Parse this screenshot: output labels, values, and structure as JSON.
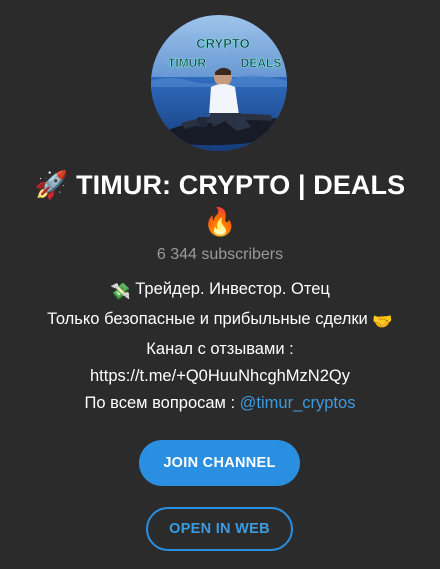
{
  "channel": {
    "title_prefix_emoji": "🚀",
    "title": "TIMUR: CRYPTO | DEALS",
    "title_suffix_emoji": "🔥",
    "subscribers": "6 344 subscribers",
    "avatar": {
      "icon": "channel-avatar",
      "text_top": "CRYPTO",
      "text_left": "TIMUR",
      "text_right": "DEALS"
    },
    "description": {
      "line1_emoji": "💸",
      "line1": "Трейдер. Инвестор. Отец",
      "line2": "Только безопасные и прибыльные сделки",
      "line2_emoji": "🤝",
      "line3": "Канал с отзывами :",
      "line4": "https://t.me/+Q0HuuNhcghMzN2Qy",
      "line5_prefix": "По всем вопросам :",
      "line5_link": "@timur_cryptos"
    }
  },
  "actions": {
    "join_label": "JOIN CHANNEL",
    "web_label": "OPEN IN WEB"
  },
  "colors": {
    "background": "#2b2b2c",
    "accent": "#2a8fe0",
    "link": "#3b9be0",
    "muted": "#9a9a9a"
  }
}
